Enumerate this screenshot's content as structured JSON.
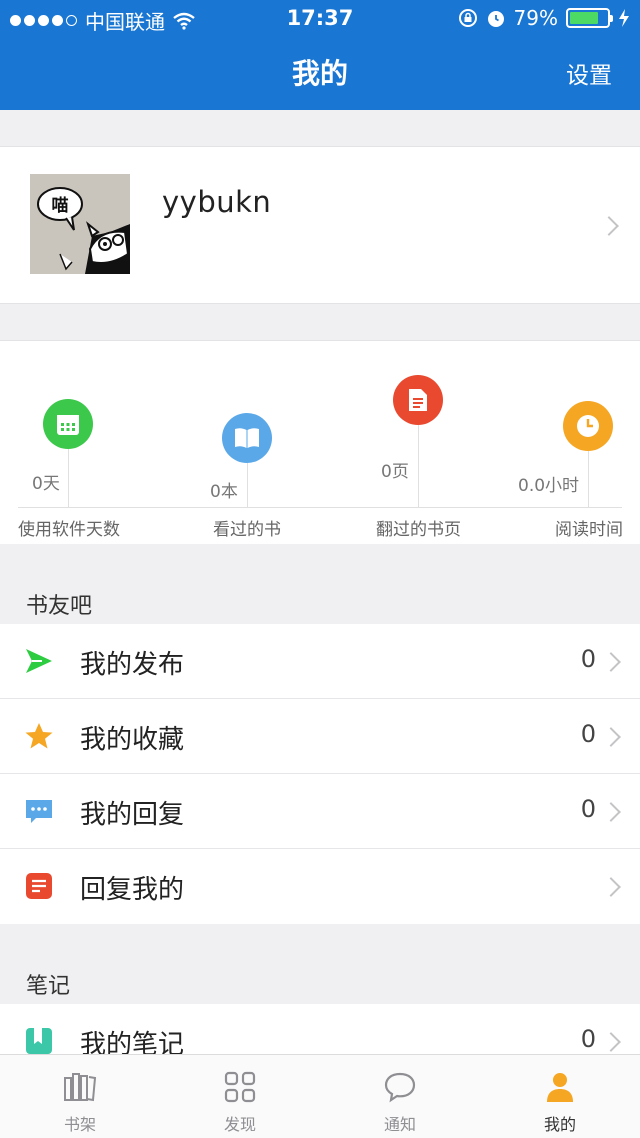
{
  "status_bar": {
    "carrier": "中国联通",
    "time": "17:37",
    "battery": "79%",
    "battery_level": 0.79
  },
  "nav": {
    "title": "我的",
    "settings_label": "设置"
  },
  "profile": {
    "username": "yybukn",
    "avatar_text": "喵"
  },
  "stats": [
    {
      "value": "0天",
      "label": "使用软件天数",
      "icon": "calendar-icon",
      "color": "#3cc84a"
    },
    {
      "value": "0本",
      "label": "看过的书",
      "icon": "book-icon",
      "color": "#5aa8e8"
    },
    {
      "value": "0页",
      "label": "翻过的书页",
      "icon": "document-icon",
      "color": "#e8492f"
    },
    {
      "value": "0.0小时",
      "label": "阅读时间",
      "icon": "clock-icon",
      "color": "#f5a623"
    }
  ],
  "book_friends": {
    "title": "书友吧",
    "items": [
      {
        "label": "我的发布",
        "count": "0",
        "icon": "send-icon"
      },
      {
        "label": "我的收藏",
        "count": "0",
        "icon": "star-icon"
      },
      {
        "label": "我的回复",
        "count": "0",
        "icon": "chat-icon"
      },
      {
        "label": "回复我的",
        "count": "",
        "icon": "note-icon"
      }
    ]
  },
  "notes": {
    "title": "笔记",
    "items": [
      {
        "label": "我的笔记",
        "count": "0",
        "icon": "bookmark-icon"
      }
    ]
  },
  "tabbar": {
    "tabs": [
      {
        "label": "书架",
        "icon": "bookshelf-icon"
      },
      {
        "label": "发现",
        "icon": "grid-icon"
      },
      {
        "label": "通知",
        "icon": "message-icon"
      },
      {
        "label": "我的",
        "icon": "person-icon",
        "active": true
      }
    ]
  },
  "colors": {
    "brand": "#1976d2",
    "send_green": "#2ecc40",
    "star": "#f5a623",
    "chat_blue": "#5aa8e8",
    "note_red": "#e8492f",
    "notes_green": "#3cc8a8",
    "tab_active": "#f5a623"
  }
}
